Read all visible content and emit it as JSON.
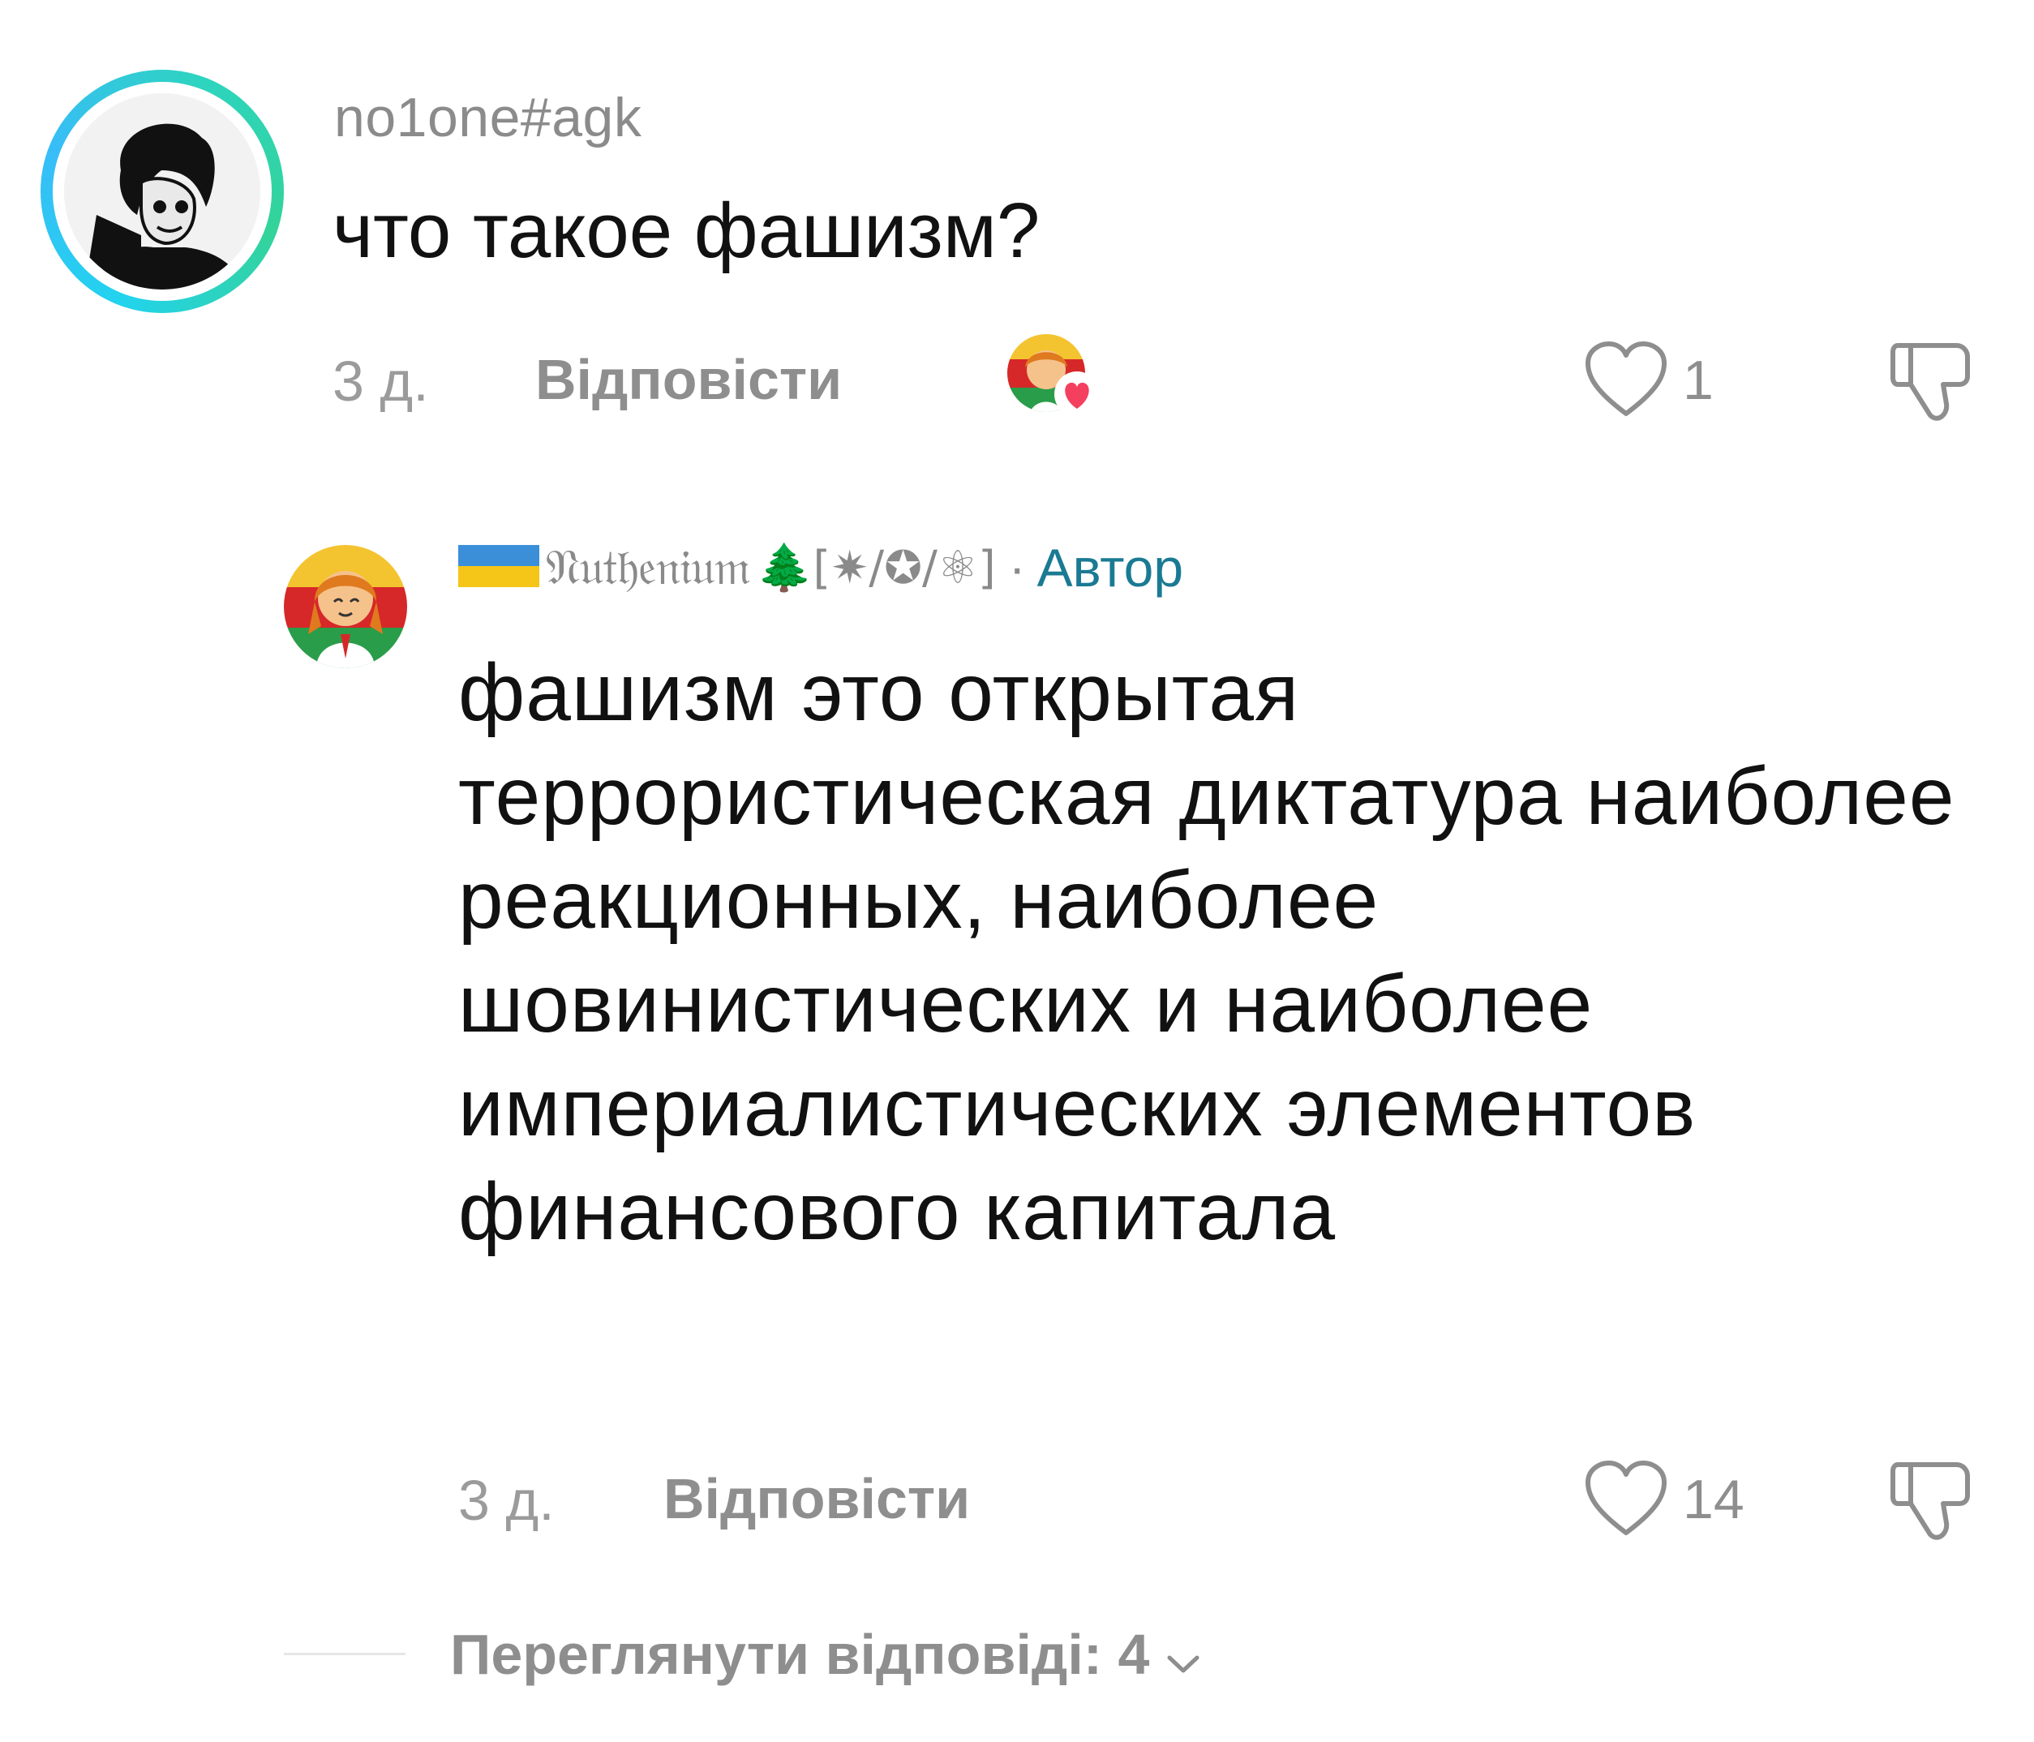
{
  "comments": [
    {
      "username": "no1one#agk",
      "text": "что такое фашизм?",
      "time": "3 д.",
      "reply_label": "Відповісти",
      "likes": "1"
    },
    {
      "author_name": "𝔑𝔲𝔱𝔥𝔢𝔫𝔦𝔲𝔪",
      "author_badges": "🌲[✷/✪/⚛]",
      "author_sep": "·",
      "author_tag": "Автор",
      "text": "фашизм это открытая террористическая диктатура наиболее реакционных, наиболее шовинистических и наиболее империалистических элементов финансового капитала",
      "time": "3 д.",
      "reply_label": "Відповісти",
      "likes": "14"
    }
  ],
  "view_replies": {
    "label": "Переглянути відповіді: 4"
  },
  "colors": {
    "accent_tag": "#1a7a93",
    "muted": "#8e8e8e",
    "ring": "#22d3ee",
    "heart_badge": "#f43f5e"
  },
  "icons": [
    "heart-icon",
    "dislike-icon",
    "chevron-down-icon",
    "creator-liked-badge"
  ]
}
